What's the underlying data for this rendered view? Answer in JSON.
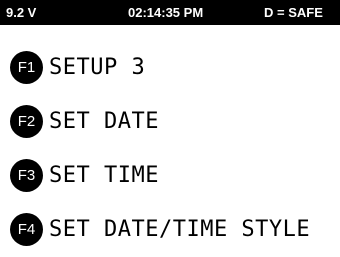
{
  "status_bar": {
    "voltage": "9.2 V",
    "time": "02:14:35 PM",
    "state": "D = SAFE"
  },
  "menu": {
    "items": [
      {
        "key": "F1",
        "label": "SETUP 3"
      },
      {
        "key": "F2",
        "label": "SET DATE"
      },
      {
        "key": "F3",
        "label": "SET TIME"
      },
      {
        "key": "F4",
        "label": "SET DATE/TIME STYLE"
      }
    ]
  },
  "colors": {
    "status_bar_bg": "#000000",
    "status_bar_text": "#ffffff",
    "screen_bg": "#ffffff",
    "badge_bg": "#000000",
    "badge_text": "#ffffff",
    "label_text": "#000000"
  }
}
